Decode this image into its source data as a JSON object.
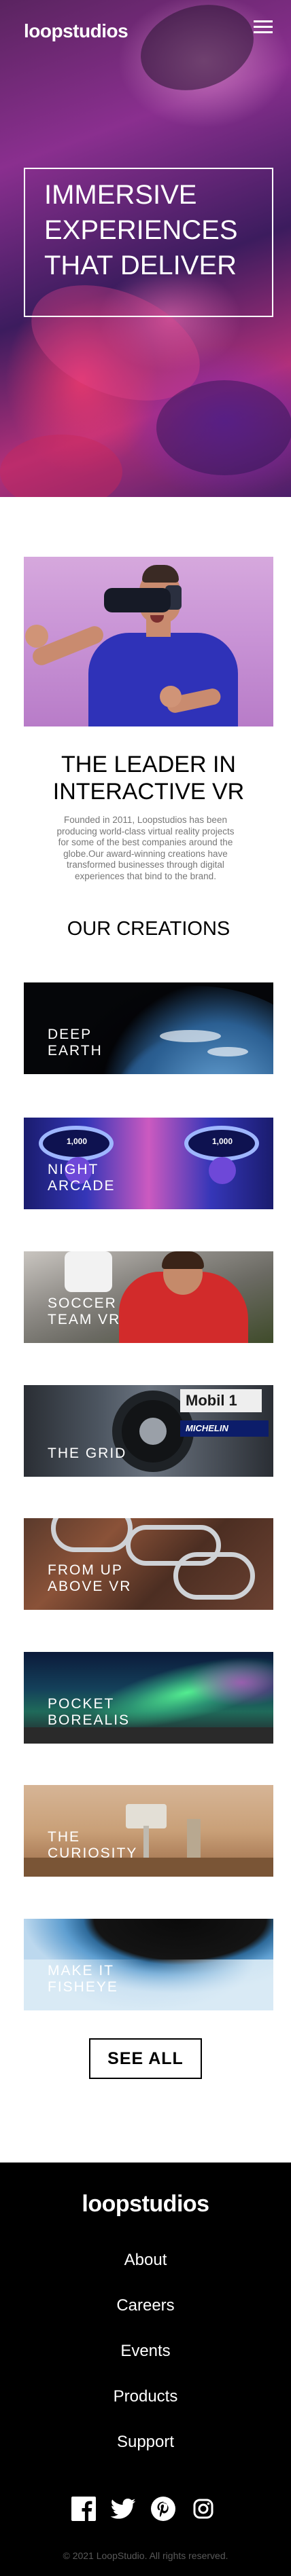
{
  "header": {
    "logo": "loopstudios",
    "menu_icon": "hamburger-menu-icon"
  },
  "hero": {
    "title": "Immersive experiences that deliver"
  },
  "intro": {
    "title": "The leader in interactive VR",
    "text": "Founded in 2011, Loopstudios has been producing world-class virtual reality projects for some of the best companies around the globe.Our award-winning creations have transformed businesses through digital experiences that bind to the brand."
  },
  "creations": {
    "title": "Our creations",
    "items": [
      {
        "label": "Deep earth"
      },
      {
        "label": "Night arcade"
      },
      {
        "label": "Soccer team VR"
      },
      {
        "label": "The grid"
      },
      {
        "label": "From up above VR"
      },
      {
        "label": "Pocket borealis"
      },
      {
        "label": "The curiosity"
      },
      {
        "label": "Make it fisheye"
      }
    ],
    "see_all": "See all",
    "grid_sponsors": {
      "mobil": "Mobil 1",
      "michelin": "MICHELIN"
    },
    "arcade_scores": [
      "1,000",
      "1,000"
    ]
  },
  "footer": {
    "logo": "loopstudios",
    "nav": [
      "About",
      "Careers",
      "Events",
      "Products",
      "Support"
    ],
    "social_icons": [
      "facebook-icon",
      "twitter-icon",
      "pinterest-icon",
      "instagram-icon"
    ],
    "copyright": "© 2021 LoopStudio. All rights reserved."
  },
  "colors": {
    "background": "#ffffff",
    "footer_background": "#000000",
    "text_primary": "#000000",
    "text_muted": "#777777",
    "copyright": "#5a5a5a"
  }
}
